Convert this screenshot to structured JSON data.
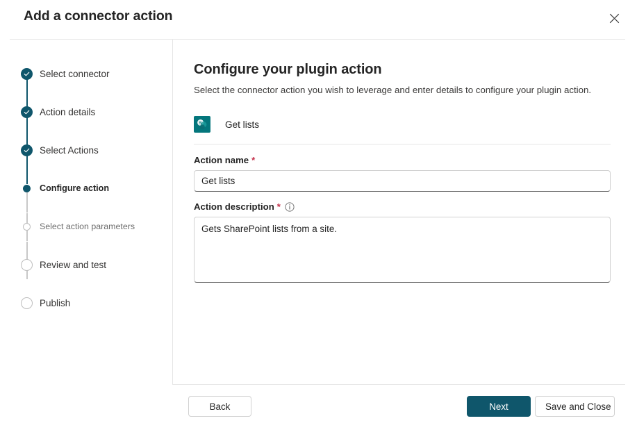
{
  "header": {
    "title": "Add a connector action",
    "close_label": "Close",
    "close_icon": "close-icon"
  },
  "sidebar": {
    "steps": [
      {
        "label": "Select connector",
        "state": "done"
      },
      {
        "label": "Action details",
        "state": "done"
      },
      {
        "label": "Select Actions",
        "state": "done"
      },
      {
        "label": "Configure action",
        "state": "current"
      },
      {
        "label": "Select action parameters",
        "state": "upcoming-small"
      },
      {
        "label": "Review and test",
        "state": "upcoming"
      },
      {
        "label": "Publish",
        "state": "upcoming"
      }
    ]
  },
  "main": {
    "title": "Configure your plugin action",
    "subtitle": "Select the connector action you wish to leverage and enter details to configure your plugin action.",
    "connector": {
      "name": "Get lists",
      "icon": "sharepoint-icon",
      "icon_color": "#04767c"
    },
    "fields": {
      "action_name": {
        "label": "Action name",
        "required_marker": "*",
        "value": "Get lists",
        "placeholder": ""
      },
      "action_description": {
        "label": "Action description",
        "required_marker": "*",
        "info_icon": "info-icon",
        "value": "Gets SharePoint lists from a site.",
        "placeholder": ""
      }
    }
  },
  "footer": {
    "back_label": "Back",
    "next_label": "Next",
    "save_label": "Save and Close"
  },
  "colors": {
    "accent": "#0f566b",
    "required": "#c4314b",
    "divider": "#e6e6e6"
  }
}
